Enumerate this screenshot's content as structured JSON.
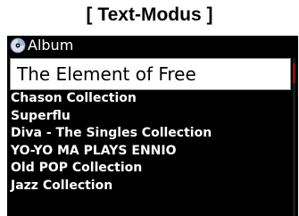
{
  "caption": "[ Text-Modus ]",
  "header": {
    "icon": "album-disc-icon",
    "title": "Album"
  },
  "selected_item": "The Element of Free",
  "items": [
    "Chason Collection",
    "Superflu",
    "Diva - The Singles Collection",
    "YO-YO MA PLAYS ENNIO",
    "Old POP Collection",
    "Jazz Collection"
  ],
  "colors": {
    "screen_background": "#000000",
    "highlight_background": "#ffffff",
    "scroll_thumb": "#8a1010"
  }
}
